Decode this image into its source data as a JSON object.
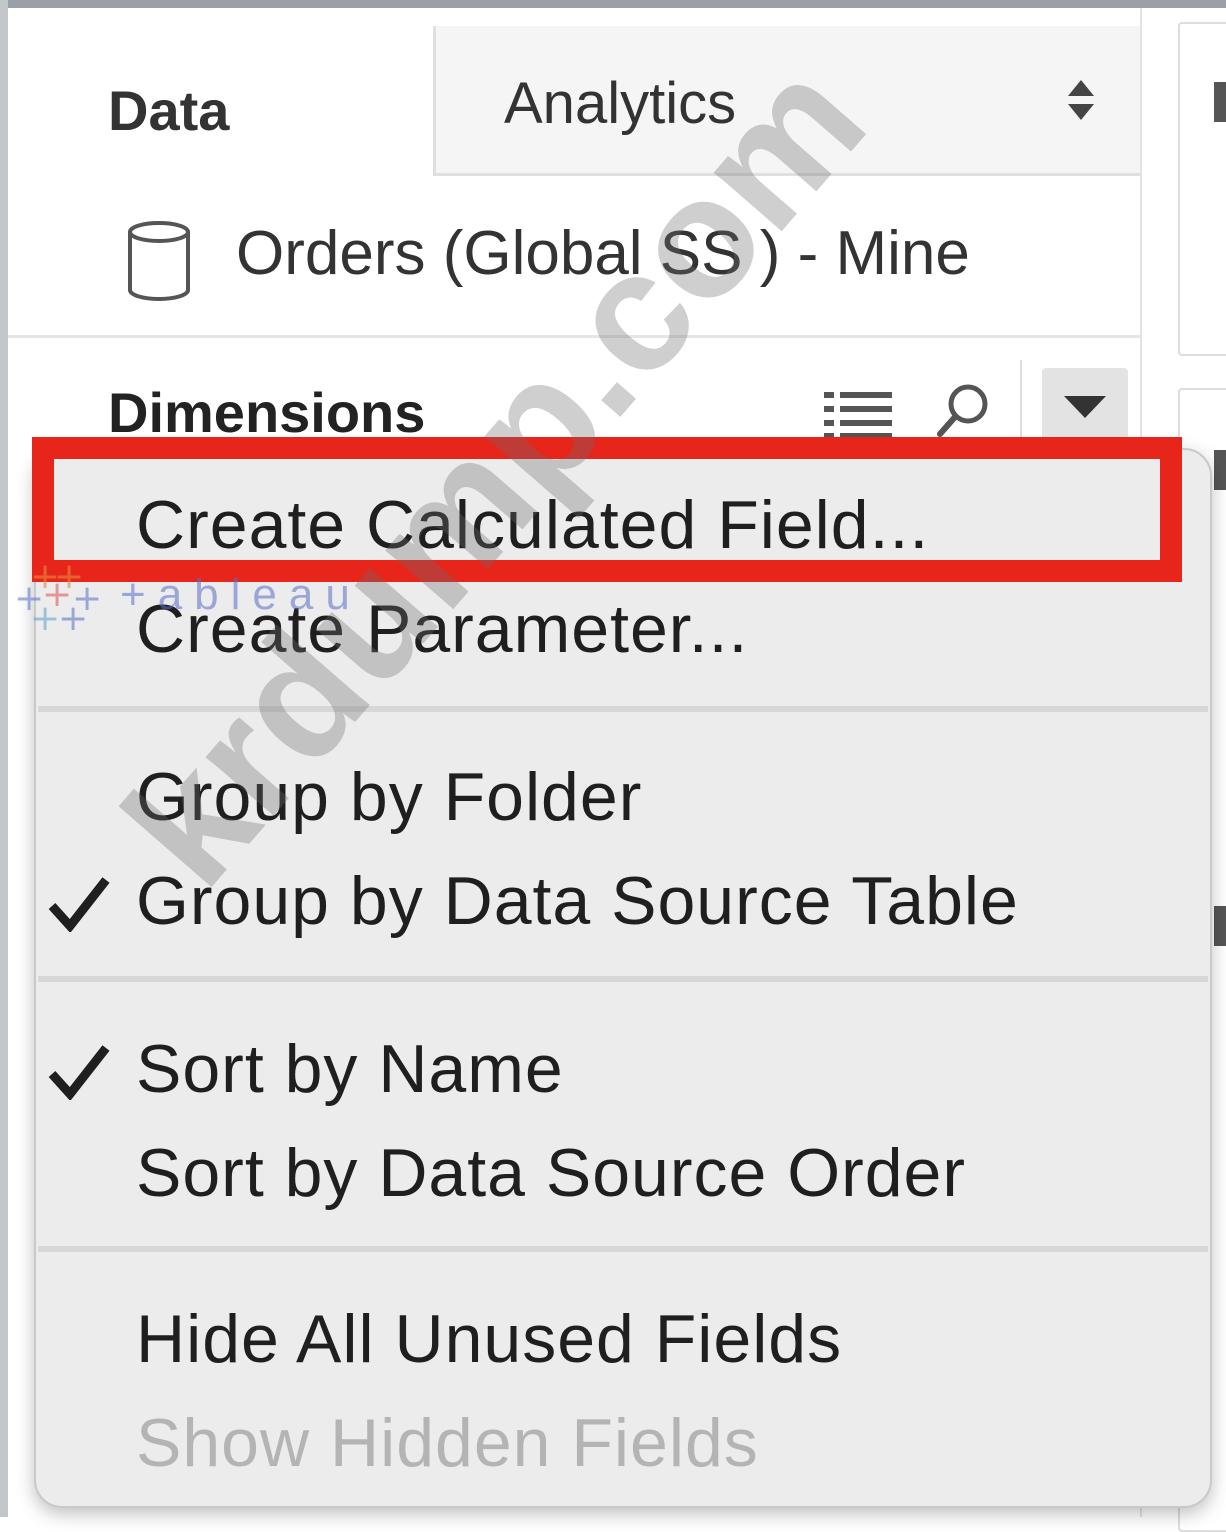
{
  "tabs": {
    "data_label": "Data",
    "analytics_label": "Analytics"
  },
  "datasource": {
    "name": "Orders (Global SS ) - Mine",
    "icon": "database-icon"
  },
  "dimensions": {
    "title": "Dimensions",
    "icons": [
      "list-view-icon",
      "search-icon",
      "dropdown-arrow-icon"
    ]
  },
  "context_menu": {
    "items": [
      {
        "label": "Create Calculated Field...",
        "checked": false,
        "enabled": true,
        "highlighted": true
      },
      {
        "label": "Create Parameter...",
        "checked": false,
        "enabled": true
      },
      {
        "label": "Group by Folder",
        "checked": false,
        "enabled": true
      },
      {
        "label": "Group by Data Source Table",
        "checked": true,
        "enabled": true
      },
      {
        "label": "Sort by Name",
        "checked": true,
        "enabled": true
      },
      {
        "label": "Sort by Data Source Order",
        "checked": false,
        "enabled": true
      },
      {
        "label": "Hide All Unused Fields",
        "checked": false,
        "enabled": true
      },
      {
        "label": "Show Hidden Fields",
        "checked": false,
        "enabled": false
      }
    ]
  },
  "highlight_color": "#e8251b",
  "watermarks": {
    "logo_text": "+ableau",
    "site_text": "krdump.com"
  }
}
